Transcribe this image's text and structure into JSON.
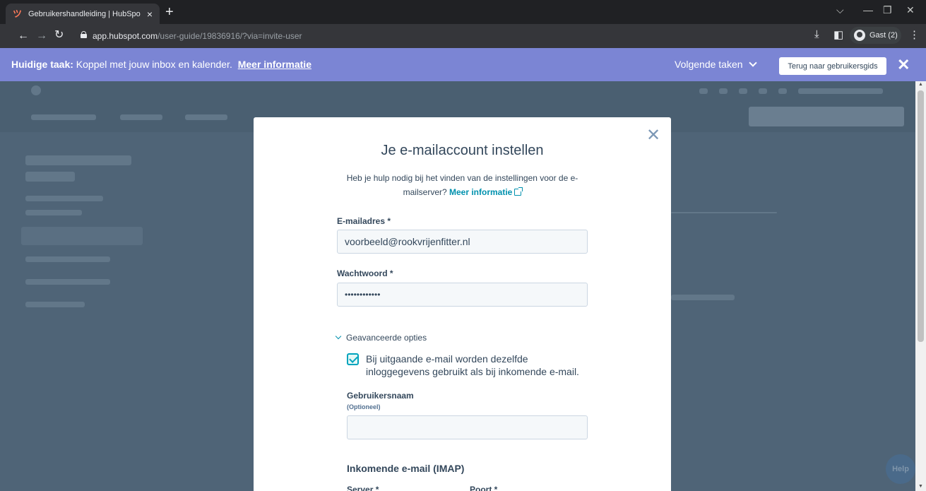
{
  "browser": {
    "tab_title": "Gebruikershandleiding | HubSpo",
    "url_host": "app.hubspot.com",
    "url_path": "/user-guide/19836916/?via=invite-user",
    "profile_label": "Gast (2)"
  },
  "banner": {
    "label": "Huidige taak:",
    "task": "Koppel met jouw inbox en kalender.",
    "more_link": "Meer informatie",
    "next_tasks": "Volgende taken",
    "back_button": "Terug naar gebruikersgids"
  },
  "modal": {
    "title": "Je e-mailaccount instellen",
    "help_text": "Heb je hulp nodig bij het vinden van de instellingen voor de e-mailserver?",
    "help_link": "Meer informatie",
    "email_label": "E-mailadres *",
    "email_value": "voorbeeld@rookvrijenfitter.nl",
    "password_label": "Wachtwoord *",
    "password_value": "••••••••••••",
    "advanced_toggle": "Geavanceerde opties",
    "same_credentials_label": "Bij uitgaande e-mail worden dezelfde inloggegevens gebruikt als bij inkomende e-mail.",
    "username_label": "Gebruikersnaam",
    "username_optional": "(Optioneel)",
    "username_value": "",
    "incoming_title": "Inkomende e-mail (IMAP)",
    "server_label": "Server *",
    "port_label": "Poort *"
  },
  "help_button": "Help"
}
